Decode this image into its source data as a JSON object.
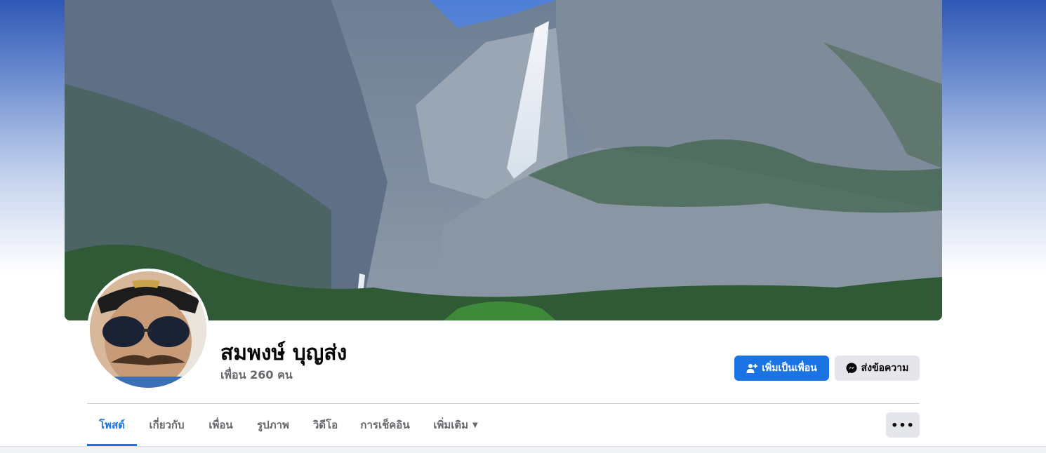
{
  "profile": {
    "name": "สมพงษ์ บุญส่ง",
    "friends": "เพื่อน 260 คน"
  },
  "actions": {
    "add_friend": "เพิ่มเป็นเพื่อน",
    "message": "ส่งข้อความ"
  },
  "tabs": [
    {
      "label": "โพสต์",
      "active": true
    },
    {
      "label": "เกี่ยวกับ"
    },
    {
      "label": "เพื่อน"
    },
    {
      "label": "รูปภาพ"
    },
    {
      "label": "วิดีโอ"
    },
    {
      "label": "การเช็คอิน"
    },
    {
      "label": "เพิ่มเติม"
    }
  ],
  "more_button": "•••",
  "icons": {
    "add_friend": "person-plus-icon",
    "message": "messenger-icon",
    "more_tab": "caret-down-icon"
  },
  "colors": {
    "accent": "#1b74e4",
    "secondary_button": "#e4e6eb",
    "muted_text": "#65676b"
  }
}
